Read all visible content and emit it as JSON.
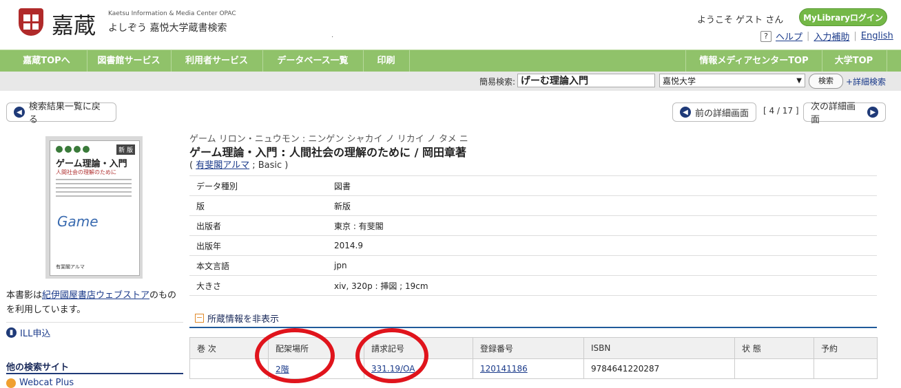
{
  "header": {
    "logo_kanji": "嘉蔵",
    "logo_en": "Kaetsu Information & Media Center OPAC",
    "logo_jp": "よしぞう 嘉悦大学蔵書検索",
    "welcome": "ようこそ ゲスト さん",
    "mylibrary_button": "MyLibraryログイン",
    "help_link": "ヘルプ",
    "input_help_link": "入力補助",
    "english_link": "English"
  },
  "nav": {
    "items": [
      "嘉蔵TOPへ",
      "図書館サービス",
      "利用者サービス",
      "データベース一覧",
      "印刷"
    ],
    "right_items": [
      "情報メディアセンターTOP",
      "大学TOP"
    ]
  },
  "search": {
    "label": "簡易検索:",
    "query": "げーむ理論入門",
    "scope": "嘉悦大学",
    "button": "検索",
    "advanced": "+詳細検索"
  },
  "paging": {
    "back_to_list": "検索結果一覧に戻る",
    "prev": "前の詳細画面",
    "next": "次の詳細画面",
    "counter": "[ 4 / 17 ]"
  },
  "cover": {
    "title": "ゲーム理論・入門",
    "subtitle": "人間社会の理解のために",
    "new_badge": "新 版",
    "game_text": "Game",
    "publisher": "有斐閣アルマ"
  },
  "left": {
    "note_prefix": "本書影は",
    "note_link": "紀伊國屋書店ウェブストア",
    "note_suffix": "のものを利用しています。",
    "ill": "ILL申込",
    "other_sites": "他の検索サイト",
    "webcat": "Webcat Plus"
  },
  "book": {
    "kana": "ゲーム リロン・ニュウモン : ニンゲン シャカイ ノ リカイ ノ タメ ニ",
    "title": "ゲーム理論・入門 : 人間社会の理解のために / 岡田章著",
    "series_open": "(",
    "series_link": "有斐閣アルマ",
    "series_rest": "; Basic )",
    "meta": [
      {
        "k": "データ種別",
        "v": "図書"
      },
      {
        "k": "版",
        "v": "新版"
      },
      {
        "k": "出版者",
        "v": "東京 : 有斐閣"
      },
      {
        "k": "出版年",
        "v": "2014.9"
      },
      {
        "k": "本文言語",
        "v": "jpn"
      },
      {
        "k": "大きさ",
        "v": "xiv, 320p : 挿図 ; 19cm"
      }
    ]
  },
  "holdings": {
    "toggle": "所蔵情報を非表示",
    "headers": [
      "巻 次",
      "配架場所",
      "請求記号",
      "登録番号",
      "ISBN",
      "状 態",
      "予約"
    ],
    "row": {
      "volume": "",
      "location": "2階",
      "call_number": "331.19/OA",
      "reg_number": "120141186",
      "isbn": "9784641220287",
      "status": "",
      "reserve": ""
    }
  },
  "colors": {
    "nav_green": "#90c26a",
    "annotation_red": "#e0141c",
    "accent_navy": "#1f3a78"
  }
}
